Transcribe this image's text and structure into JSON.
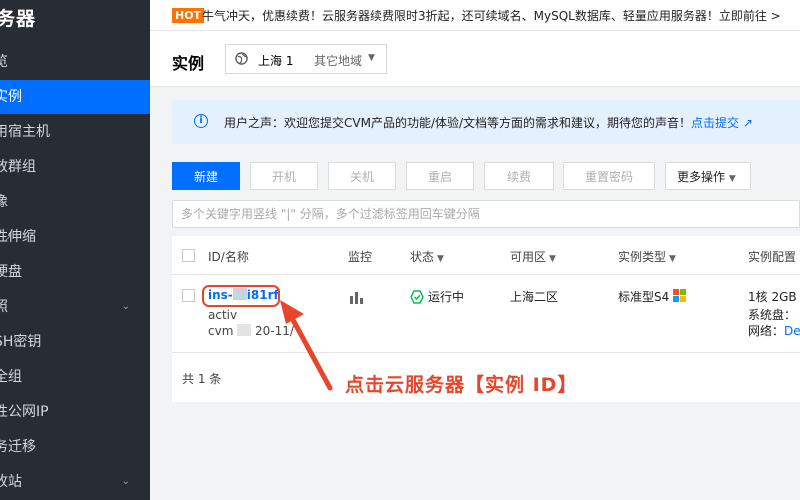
{
  "sidebar": {
    "title": "务器",
    "items": [
      {
        "label": "览"
      },
      {
        "label": "实例"
      },
      {
        "label": "用宿主机"
      },
      {
        "label": "放群组"
      },
      {
        "label": "像"
      },
      {
        "label": "性伸缩"
      },
      {
        "label": "硬盘"
      },
      {
        "label": "照"
      },
      {
        "label": "SH密钥"
      },
      {
        "label": "全组"
      },
      {
        "label": "性公网IP"
      },
      {
        "label": "务迁移"
      },
      {
        "label": "收站"
      }
    ]
  },
  "banner": {
    "badge": "HOT",
    "text": "牛气冲天，优惠续费！云服务器续费限时3折起，还可续域名、MySQL数据库、轻量应用服务器！立即前往 >"
  },
  "header": {
    "title": "实例",
    "region": "上海 1",
    "other_region": "其它地域"
  },
  "notice": {
    "text": "用户之声：欢迎您提交CVM产品的功能/体验/文档等方面的需求和建议，期待您的声音！",
    "link": "点击提交"
  },
  "toolbar": {
    "new": "新建",
    "start": "开机",
    "stop": "关机",
    "restart": "重启",
    "renew": "续费",
    "reset_password": "重置密码",
    "more": "更多操作"
  },
  "search": {
    "placeholder": "多个关键字用竖线 \"|\" 分隔，多个过滤标签用回车键分隔"
  },
  "table": {
    "headers": {
      "id": "ID/名称",
      "monitor": "监控",
      "status": "状态",
      "zone": "可用区",
      "type": "实例类型",
      "config": "实例配置"
    },
    "row": {
      "id_start": "ins-",
      "id_end": "i81rf",
      "name_line": "activ",
      "name_line2_start": "cvm",
      "name_line2_end": "20-11/",
      "status": "运行中",
      "zone": "上海二区",
      "type": "标准型S4",
      "config1": "1核 2GB",
      "config2": "系统盘：",
      "config3_label": "网络：",
      "config3_link": "De"
    },
    "total": "共 1 条"
  },
  "annotation": {
    "text": "点击云服务器【实例 ID】",
    "color": "#e8462a"
  },
  "colors": {
    "accent": "#006eff",
    "sidebar_bg": "#282c35",
    "hot": "#ff7200",
    "running": "#0abf5b"
  }
}
